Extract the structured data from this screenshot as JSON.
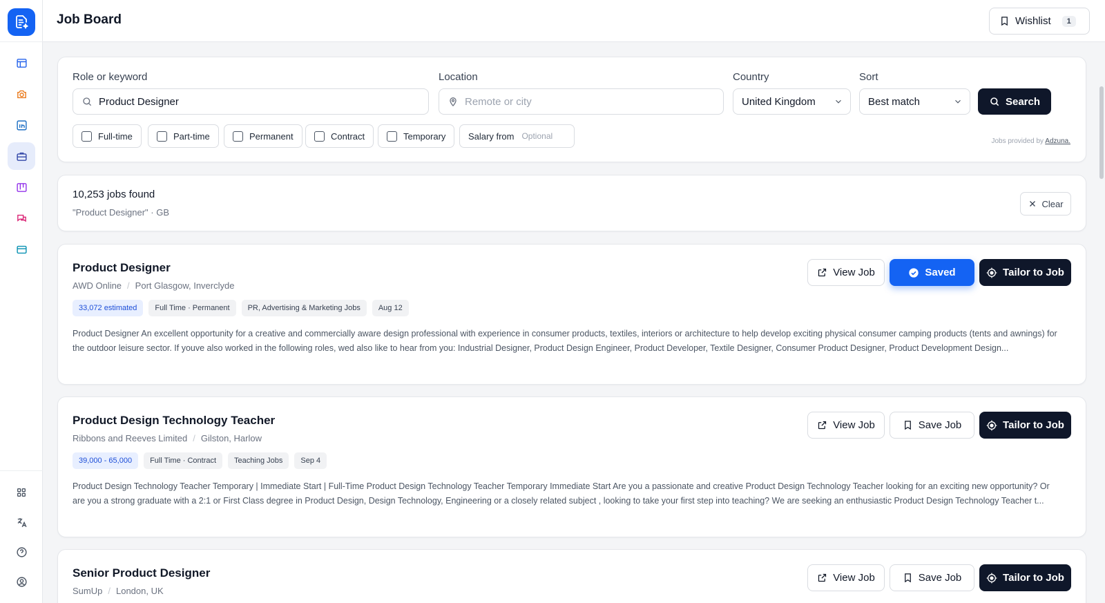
{
  "app": {
    "title": "Job Board"
  },
  "colors": {
    "accent": "#1463f3",
    "dark": "#0f172a",
    "salary_tag_text": "#1d4ed8"
  },
  "sidebar": {
    "items": [
      {
        "name": "dashboard",
        "icon": "layout-icon"
      },
      {
        "name": "camera",
        "icon": "camera-icon"
      },
      {
        "name": "linkedin",
        "icon": "linkedin-icon"
      },
      {
        "name": "job-board",
        "icon": "briefcase-icon",
        "active": true
      },
      {
        "name": "kanban",
        "icon": "kanban-icon"
      },
      {
        "name": "messages",
        "icon": "chat-icon"
      },
      {
        "name": "browser",
        "icon": "window-icon"
      }
    ],
    "bottom": [
      {
        "name": "apps",
        "icon": "grid-icon"
      },
      {
        "name": "language",
        "icon": "translate-icon"
      },
      {
        "name": "help",
        "icon": "help-icon"
      },
      {
        "name": "account",
        "icon": "user-icon"
      }
    ]
  },
  "header": {
    "wishlist_label": "Wishlist",
    "wishlist_count": "1"
  },
  "search": {
    "role_label": "Role or keyword",
    "role_value": "Product Designer",
    "location_label": "Location",
    "location_placeholder": "Remote or city",
    "country_label": "Country",
    "country_value": "United Kingdom",
    "sort_label": "Sort",
    "sort_value": "Best match",
    "search_button": "Search",
    "filters": [
      "Full-time",
      "Part-time",
      "Permanent",
      "Contract",
      "Temporary"
    ],
    "salary_label": "Salary from",
    "salary_placeholder": "Optional",
    "provider_prefix": "Jobs provided by",
    "provider_name": "Adzuna."
  },
  "results": {
    "count": "10,253 jobs found",
    "query": "\"Product Designer\" · GB",
    "clear_button": "Clear"
  },
  "jobs": [
    {
      "title": "Product Designer",
      "company": "AWD Online",
      "location": "Port Glasgow, Inverclyde",
      "tags": [
        "33,072 estimated",
        "Full Time · Permanent",
        "PR, Advertising & Marketing Jobs",
        "Aug 12"
      ],
      "description": "Product Designer An excellent opportunity for a creative and commercially aware design professional with experience in consumer products, textiles, interiors or architecture to help develop exciting physical consumer camping products (tents and awnings) for the outdoor leisure sector. If youve also worked in the following roles, wed also like to hear from you: Industrial Designer, Product Design Engineer, Product Developer, Textile Designer, Consumer Product Designer, Product Development Design...",
      "view_label": "View Job",
      "save_label": "Saved",
      "saved": true,
      "tailor_label": "Tailor to Job"
    },
    {
      "title": "Product Design Technology Teacher",
      "company": "Ribbons and Reeves Limited",
      "location": "Gilston, Harlow",
      "tags": [
        "39,000 - 65,000",
        "Full Time · Contract",
        "Teaching Jobs",
        "Sep 4"
      ],
      "description": "Product Design Technology Teacher Temporary | Immediate Start | Full-Time Product Design Technology Teacher Temporary Immediate Start Are you a passionate and creative Product Design Technology Teacher looking for an exciting new opportunity? Or are you a strong graduate with a 2:1 or First Class degree in Product Design, Design Technology, Engineering or a closely related subject , looking to take your first step into teaching? We are seeking an enthusiastic Product Design Technology Teacher t...",
      "view_label": "View Job",
      "save_label": "Save Job",
      "saved": false,
      "tailor_label": "Tailor to Job"
    },
    {
      "title": "Senior Product Designer",
      "company": "SumUp",
      "location": "London, UK",
      "tags": [],
      "description": "",
      "view_label": "View Job",
      "save_label": "Save Job",
      "saved": false,
      "tailor_label": "Tailor to Job"
    }
  ]
}
